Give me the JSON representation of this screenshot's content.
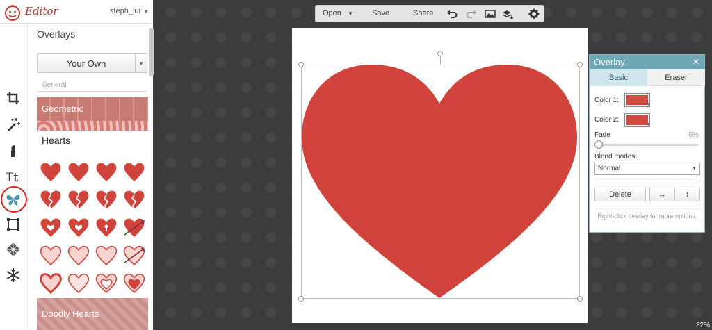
{
  "app": {
    "title": "Editor",
    "user": "steph_lui"
  },
  "panel": {
    "title": "Overlays",
    "your_own_label": "Your Own",
    "section_label": "General",
    "categories": {
      "geometric": "Geometric",
      "hearts": "Hearts",
      "doodly": "Doodly Hearts"
    }
  },
  "toolbar": {
    "open_label": "Open",
    "save_label": "Save",
    "share_label": "Share"
  },
  "overlay": {
    "title": "Overlay",
    "tab_basic": "Basic",
    "tab_eraser": "Eraser",
    "color1_label": "Color 1:",
    "color2_label": "Color 2:",
    "color1": "#d14a41",
    "color2": "#d14a41",
    "fade_label": "Fade",
    "fade_value": "0%",
    "fade_fraction": 0,
    "blend_label": "Blend modes:",
    "blend_value": "Normal",
    "delete_label": "Delete",
    "flip_h_glyph": "↔",
    "flip_v_glyph": "↕",
    "hint": "Right-click overlay for more options."
  },
  "zoom": "32%",
  "colors": {
    "accent": "#6ea6b3",
    "heart": "#cf433a",
    "highlight": "#d92121"
  }
}
